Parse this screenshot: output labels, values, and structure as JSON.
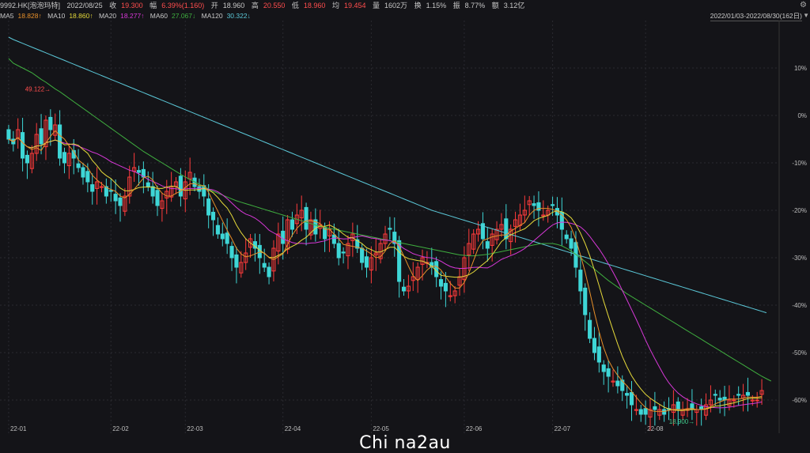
{
  "header": {
    "ticker": "9992.HK[泡泡玛特]",
    "date": "2022/08/25",
    "close_label": "收",
    "close": "19.300",
    "change_label": "幅",
    "change": "6.39%(1.160)",
    "open_label": "开",
    "open": "18.960",
    "high_label": "高",
    "high": "20.550",
    "low_label": "低",
    "low": "18.960",
    "avg_label": "均",
    "avg": "19.454",
    "volume_label": "量",
    "volume": "1602万",
    "turnover_label": "换",
    "turnover": "1.15%",
    "amplitude_label": "振",
    "amplitude": "8.77%",
    "amount_label": "额",
    "amount": "3.12亿"
  },
  "ma_bar": [
    {
      "label": "MA5",
      "value": "18.828↑",
      "color": "#e8902a"
    },
    {
      "label": "MA10",
      "value": "18.860↑",
      "color": "#e5d93a"
    },
    {
      "label": "MA20",
      "value": "18.277↑",
      "color": "#d838d8"
    },
    {
      "label": "MA60",
      "value": "27.067↓",
      "color": "#3fae3f"
    },
    {
      "label": "MA120",
      "value": "30.322↓",
      "color": "#5bc8d8"
    }
  ],
  "range_label": "2022/01/03-2022/08/30(162日)",
  "watermark": "Chi na2au",
  "colors": {
    "up": "#ff3b3b",
    "down": "#3ed6d6",
    "bg": "#141418",
    "grid": "#2a2a30",
    "axis_text": "#bdbdbd",
    "max_label": "#ff4d4d",
    "min_label": "#3ec98a"
  },
  "chart_data": {
    "type": "candlestick",
    "y_axis": {
      "unit": "%",
      "ticks": [
        "10%",
        "0%",
        "-10%",
        "-20%",
        "-30%",
        "-40%",
        "-50%",
        "-60%"
      ],
      "tick_values": [
        10,
        0,
        -10,
        -20,
        -30,
        -40,
        -50,
        -60
      ],
      "ylim": [
        -67,
        20
      ],
      "position": "right"
    },
    "x_axis": {
      "ticks": [
        "22-01",
        "22-02",
        "22-03",
        "22-04",
        "22-05",
        "22-06",
        "22-07",
        "22-08"
      ],
      "tick_index": [
        0,
        22,
        38,
        59,
        78,
        98,
        117,
        137
      ]
    },
    "max_annotation": {
      "value": "49.122",
      "index": 10
    },
    "min_annotation": {
      "value": "18.900",
      "index": 148
    },
    "close_pct": [
      -5,
      -6,
      -3,
      -9,
      -10,
      -8,
      -4,
      -6,
      -1,
      -3,
      -2,
      -9,
      -10,
      -8,
      -9,
      -11,
      -13,
      -14,
      -16,
      -14,
      -15,
      -17,
      -16,
      -18,
      -19,
      -17,
      -13,
      -11,
      -12,
      -13,
      -15,
      -17,
      -19,
      -18,
      -16,
      -15,
      -14,
      -17,
      -14,
      -12,
      -15,
      -16,
      -17,
      -21,
      -22,
      -25,
      -26,
      -27,
      -30,
      -32,
      -31,
      -29,
      -26,
      -28,
      -30,
      -32,
      -34,
      -28,
      -25,
      -27,
      -22,
      -24,
      -21,
      -20,
      -24,
      -22,
      -25,
      -23,
      -26,
      -24,
      -27,
      -30,
      -29,
      -27,
      -25,
      -28,
      -31,
      -32,
      -30,
      -29,
      -27,
      -25,
      -24,
      -27,
      -35,
      -37,
      -36,
      -34,
      -32,
      -30,
      -31,
      -32,
      -34,
      -36,
      -37,
      -38,
      -37,
      -34,
      -30,
      -27,
      -25,
      -24,
      -26,
      -28,
      -25,
      -24,
      -23,
      -26,
      -24,
      -22,
      -21,
      -20,
      -18,
      -19,
      -20,
      -21,
      -20,
      -19,
      -21,
      -24,
      -26,
      -28,
      -32,
      -37,
      -42,
      -47,
      -50,
      -52,
      -54,
      -55,
      -56,
      -57,
      -58,
      -59,
      -61,
      -62,
      -63,
      -63,
      -62,
      -62,
      -62,
      -63,
      -62,
      -61,
      -62,
      -62,
      -62,
      -62,
      -62,
      -62,
      -61,
      -60,
      -59,
      -60,
      -60,
      -60,
      -60,
      -59,
      -59,
      -59,
      -60,
      -60,
      -58
    ],
    "ma_series": [
      {
        "name": "MA5",
        "color": "#e8902a"
      },
      {
        "name": "MA10",
        "color": "#e5d93a"
      },
      {
        "name": "MA20",
        "color": "#d838d8"
      },
      {
        "name": "MA60",
        "color": "#3fae3f"
      },
      {
        "name": "MA120",
        "color": "#5bc8d8"
      }
    ],
    "ma60_pct": [
      12,
      11,
      10.5,
      10,
      9.5,
      9,
      8.3,
      7.6,
      7,
      6.3,
      5.6,
      5,
      4.3,
      3.6,
      2.9,
      2.2,
      1.5,
      0.8,
      0.1,
      -0.6,
      -1.3,
      -2,
      -2.7,
      -3.4,
      -4.1,
      -4.8,
      -5.5,
      -6.2,
      -6.9,
      -7.6,
      -8.2,
      -8.8,
      -9.4,
      -10,
      -10.6,
      -11.2,
      -11.8,
      -12.4,
      -13,
      -13.5,
      -14,
      -14.5,
      -15,
      -15.5,
      -16,
      -16.4,
      -16.8,
      -17.2,
      -17.6,
      -18,
      -18.3,
      -18.6,
      -18.9,
      -19.2,
      -19.5,
      -19.8,
      -20.1,
      -20.4,
      -20.7,
      -21,
      -21.3,
      -21.6,
      -21.9,
      -22.2,
      -22.5,
      -22.8,
      -23.1,
      -23.4,
      -23.6,
      -23.8,
      -24,
      -24.2,
      -24.4,
      -24.6,
      -24.8,
      -25,
      -25.2,
      -25.4,
      -25.6,
      -25.8,
      -26,
      -26.2,
      -26.4,
      -26.6,
      -26.8,
      -27,
      -27.2,
      -27.4,
      -27.6,
      -27.8,
      -28,
      -28.2,
      -28.4,
      -28.6,
      -28.8,
      -29,
      -29.2,
      -29.4,
      -29.5,
      -29.6,
      -29.6,
      -29.5,
      -29.4,
      -29.3,
      -29.1,
      -28.9,
      -28.7,
      -28.5,
      -28.3,
      -28.1,
      -27.9,
      -27.7,
      -27.5,
      -27.3,
      -27.1,
      -27,
      -27,
      -27,
      -27.2,
      -27.5,
      -28,
      -28.6,
      -29.3,
      -30,
      -30.8,
      -31.6,
      -32.4,
      -33.2,
      -34,
      -34.8,
      -35.5,
      -36.2,
      -36.9,
      -37.6,
      -38.2,
      -38.8,
      -39.4,
      -40,
      -40.6,
      -41.2,
      -41.8,
      -42.4,
      -43,
      -43.6,
      -44.2,
      -44.8,
      -45.4,
      -46,
      -46.6,
      -47.2,
      -47.8,
      -48.4,
      -49,
      -49.6,
      -50.2,
      -50.8,
      -51.4,
      -52,
      -52.6,
      -53.2,
      -53.8,
      -54.4,
      -55,
      -55.5,
      -56
    ],
    "ma120_pct": [
      16.5,
      16,
      15.6,
      15.2,
      14.8,
      14.4,
      14,
      13.6,
      13.2,
      12.8,
      12.4,
      12,
      11.6,
      11.2,
      10.8,
      10.4,
      10,
      9.6,
      9.2,
      8.8,
      8.4,
      8,
      7.6,
      7.2,
      6.8,
      6.4,
      6,
      5.6,
      5.2,
      4.8,
      4.4,
      4,
      3.6,
      3.2,
      2.8,
      2.4,
      2,
      1.6,
      1.2,
      0.8,
      0.4,
      0,
      -0.4,
      -0.8,
      -1.2,
      -1.6,
      -2,
      -2.4,
      -2.8,
      -3.2,
      -3.6,
      -4,
      -4.4,
      -4.8,
      -5.2,
      -5.6,
      -6,
      -6.4,
      -6.8,
      -7.2,
      -7.6,
      -8,
      -8.4,
      -8.8,
      -9.2,
      -9.6,
      -10,
      -10.4,
      -10.8,
      -11.2,
      -11.6,
      -12,
      -12.4,
      -12.8,
      -13.2,
      -13.6,
      -14,
      -14.4,
      -14.8,
      -15.2,
      -15.6,
      -16,
      -16.4,
      -16.8,
      -17.2,
      -17.6,
      -18,
      -18.4,
      -18.8,
      -19.2,
      -19.6,
      -20,
      -20.3,
      -20.6,
      -20.9,
      -21.2,
      -21.5,
      -21.8,
      -22.1,
      -22.4,
      -22.7,
      -23,
      -23.3,
      -23.6,
      -23.9,
      -24.2,
      -24.5,
      -24.8,
      -25.1,
      -25.4,
      -25.7,
      -26,
      -26.3,
      -26.6,
      -26.9,
      -27.2,
      -27.5,
      -27.8,
      -28.1,
      -28.4,
      -28.7,
      -29,
      -29.3,
      -29.6,
      -29.9,
      -30.2,
      -30.5,
      -30.8,
      -31.1,
      -31.4,
      -31.7,
      -32,
      -32.3,
      -32.6,
      -32.9,
      -33.2,
      -33.5,
      -33.8,
      -34.1,
      -34.4,
      -34.7,
      -35,
      -35.3,
      -35.6,
      -35.9,
      -36.2,
      -36.5,
      -36.8,
      -37.1,
      -37.4,
      -37.7,
      -38,
      -38.3,
      -38.6,
      -38.9,
      -39.2,
      -39.5,
      -39.8,
      -40.1,
      -40.4,
      -40.7,
      -41,
      -41.3,
      -41.6
    ]
  }
}
